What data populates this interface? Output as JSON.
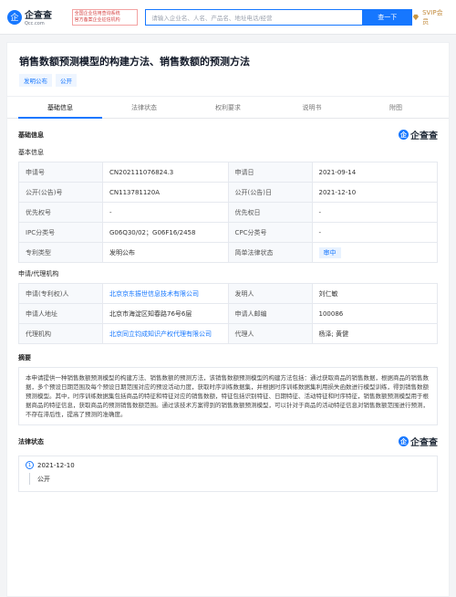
{
  "topbar": {
    "logo_char": "企",
    "logo_name": "企查查",
    "logo_domain": "Qcc.com",
    "logo_badge_line1": "全国企业信用查询系统",
    "logo_badge_line2": "官方备案企业征信机构",
    "search_placeholder": "请输入企业名、人名、产品名、地址电话/经营",
    "search_button": "查一下",
    "vip_label": "SVIP会员"
  },
  "patent": {
    "title": "销售数额预测模型的构建方法、销售数额的预测方法",
    "tags": [
      "发明公布",
      "公开"
    ]
  },
  "tabs": [
    "基础信息",
    "法律状态",
    "权利要求",
    "说明书",
    "附图"
  ],
  "basic": {
    "section_title": "基础信息",
    "subsection_title": "基本信息",
    "brand_char": "企",
    "brand_name": "企查查",
    "rows": [
      {
        "k1": "申请号",
        "v1": "CN202111076824.3",
        "k2": "申请日",
        "v2": "2021-09-14"
      },
      {
        "k1": "公开(公告)号",
        "v1": "CN113781120A",
        "k2": "公开(公告)日",
        "v2": "2021-12-10"
      },
      {
        "k1": "优先权号",
        "v1": "-",
        "k2": "优先权日",
        "v2": "-"
      },
      {
        "k1": "IPC分类号",
        "v1": "G06Q30/02；G06F16/2458",
        "k2": "CPC分类号",
        "v2": "-"
      },
      {
        "k1": "专利类型",
        "v1": "发明公布",
        "k2": "简单法律状态",
        "v2": "审中"
      }
    ]
  },
  "applicant": {
    "subsection_title": "申请/代理机构",
    "rows": [
      {
        "k1": "申请(专利权)人",
        "v1": "北京京东振世信息技术有限公司",
        "k2": "发明人",
        "v2": "刘仁敏"
      },
      {
        "k1": "申请人地址",
        "v1": "北京市海淀区知春路76号6层",
        "k2": "申请人邮编",
        "v2": "100086"
      },
      {
        "k1": "代理机构",
        "v1": "北京同立钧成知识产权代理有限公司",
        "k2": "代理人",
        "v2": "杨泽; 黄健"
      }
    ]
  },
  "summary": {
    "title": "摘要",
    "text": "本申请提供一种销售数额预测模型的构建方法、销售数额的预测方法，该销售数额预测模型的构建方法包括：通过获取商品的销售数据，根据商品的销售数据，多个预设日期范围及每个预设日期范围对应的预设活动力度，获取时序训练数据集，并根据时序训练数据集利用损失函数进行模型训练，得到销售数额预测模型。其中，时序训练数据集包括商品的特征和特征对应的销售数额，特征包括识别特征、日期特征、活动特征和时序特征，销售数额预测模型用于根据商品的特征信息，获取商品的预测销售数额范围。通过该技术方案得到的销售数额预测模型，可以针对于商品的活动特征信息对销售数额范围进行预测，不存在滞后性，提高了预测的准确度。"
  },
  "legal": {
    "title": "法律状态",
    "brand_char": "企",
    "brand_name": "企查查",
    "timeline": [
      {
        "index": "1",
        "date": "2021-12-10",
        "status": "公开"
      }
    ]
  }
}
